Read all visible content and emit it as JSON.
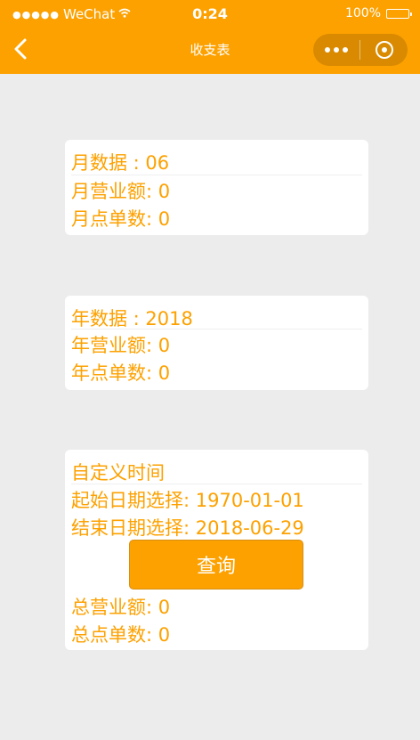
{
  "status_bar": {
    "signal_dots": "●●●●●",
    "carrier": "WeChat",
    "time": "0:24",
    "battery": "100%"
  },
  "nav": {
    "title": "收支表"
  },
  "monthly": {
    "title": "月数据 : 06",
    "revenue": "月营业额:  0",
    "orders": "月点单数:  0"
  },
  "yearly": {
    "title": "年数据 : 2018",
    "revenue": "年营业额:  0",
    "orders": "年点单数:  0"
  },
  "custom": {
    "title": "自定义时间",
    "start": "起始日期选择: 1970-01-01",
    "end": "结束日期选择: 2018-06-29",
    "query_label": "查询",
    "total_revenue": "总营业额:  0",
    "total_orders": "总点单数:  0"
  },
  "colors": {
    "accent": "#fda100",
    "background": "#ececec",
    "card": "#ffffff"
  }
}
